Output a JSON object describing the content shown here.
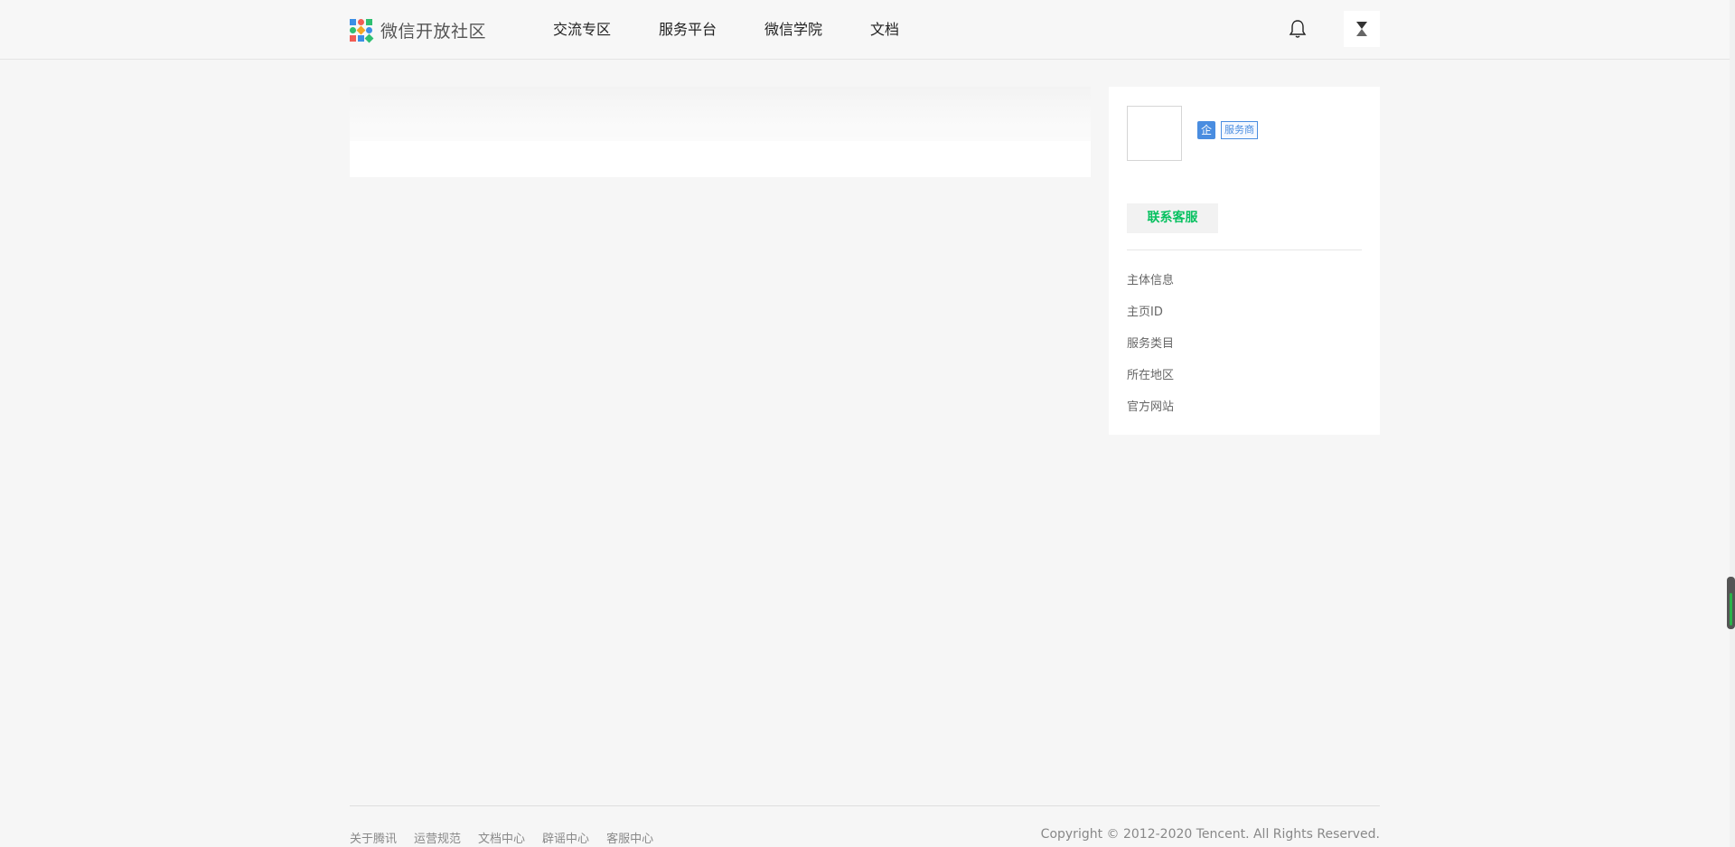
{
  "header": {
    "logo_text": "微信开放社区",
    "nav": [
      {
        "label": "交流专区"
      },
      {
        "label": "服务平台"
      },
      {
        "label": "微信学院"
      },
      {
        "label": "文档"
      }
    ],
    "icons": [
      "bell-icon",
      "user-avatar-icon"
    ]
  },
  "sidebar": {
    "badge_enterprise": "企",
    "badge_provider": "服务商",
    "contact_button": "联系客服",
    "info_items": [
      {
        "label": "主体信息"
      },
      {
        "label": "主页ID"
      },
      {
        "label": "服务类目"
      },
      {
        "label": "所在地区"
      },
      {
        "label": "官方网站"
      }
    ]
  },
  "footer": {
    "links": [
      {
        "label": "关于腾讯"
      },
      {
        "label": "运营规范"
      },
      {
        "label": "文档中心"
      },
      {
        "label": "辟谣中心"
      },
      {
        "label": "客服中心"
      }
    ],
    "copyright": "Copyright © 2012-2020 Tencent. All Rights Reserved."
  },
  "colors": {
    "brand_green": "#07c160",
    "badge_blue": "#4a8de0",
    "page_bg": "#f6f6f6"
  }
}
